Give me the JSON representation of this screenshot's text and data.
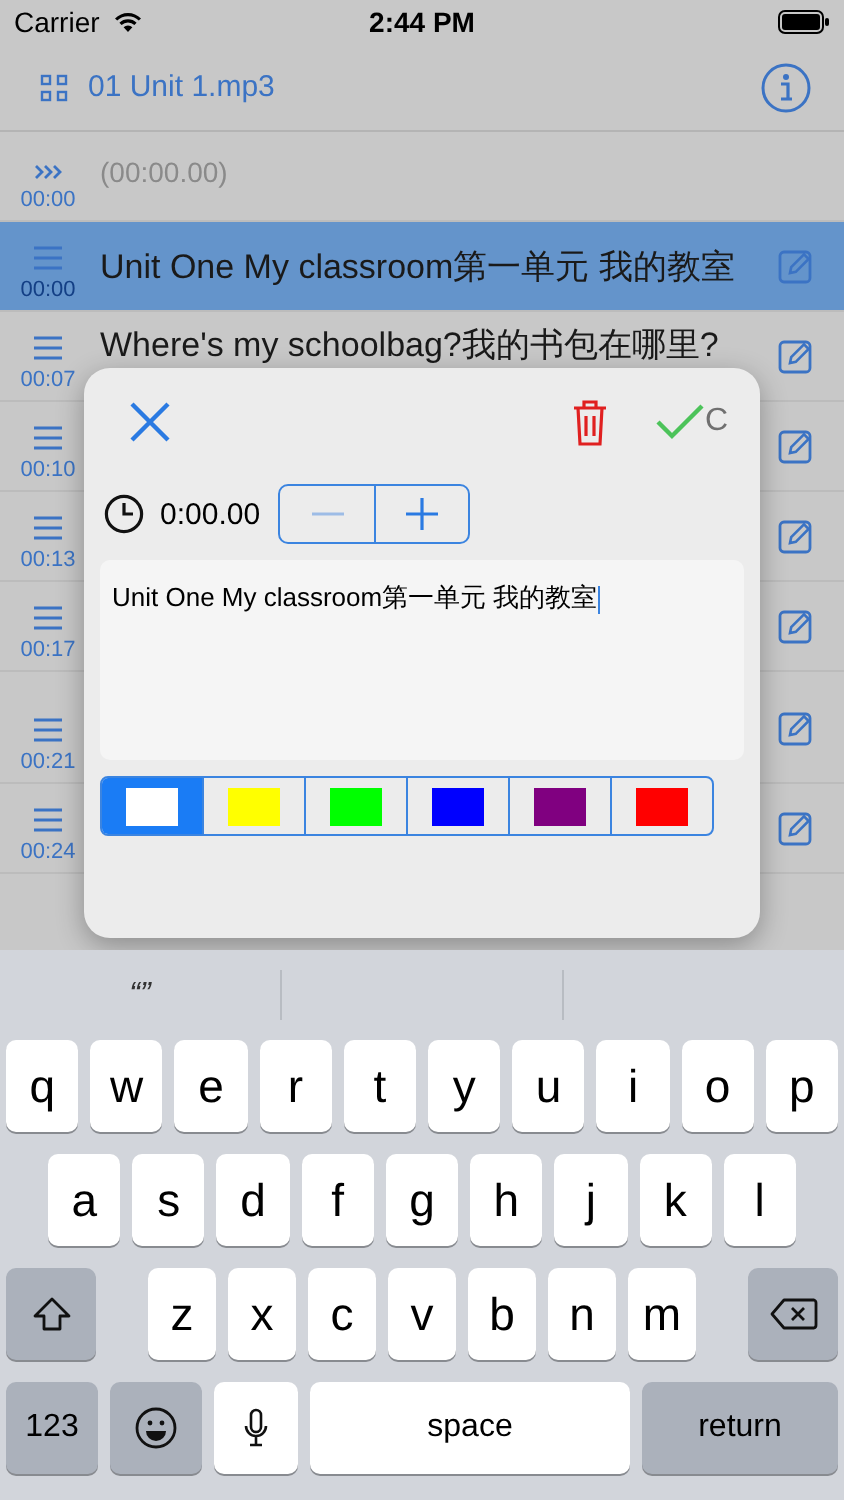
{
  "status_bar": {
    "carrier": "Carrier",
    "time": "2:44 PM"
  },
  "header": {
    "title": "01 Unit 1.mp3"
  },
  "rows": [
    {
      "kind": "start",
      "time": "00:00",
      "text": "(00:00.00)",
      "selected": false
    },
    {
      "kind": "line",
      "time": "00:00",
      "text": "Unit One My classroom第一单元 我的教室",
      "selected": true
    },
    {
      "kind": "line",
      "time": "00:07",
      "text": "Where's my schoolbag?我的书包在哪里?",
      "selected": false
    },
    {
      "kind": "line",
      "time": "00:10",
      "selected": false
    },
    {
      "kind": "line",
      "time": "00:13",
      "selected": false
    },
    {
      "kind": "line",
      "time": "00:17",
      "selected": false
    },
    {
      "kind": "tall",
      "time": "00:21",
      "selected": false
    },
    {
      "kind": "line",
      "time": "00:24",
      "selected": false
    }
  ],
  "dialog": {
    "confirm_label": "C",
    "time": "0:00.00",
    "decrement_disabled": true,
    "text": "Unit One My classroom第一单元 我的教室",
    "colors": [
      {
        "color": "#ffffff",
        "selected": true
      },
      {
        "color": "#ffff00",
        "selected": false
      },
      {
        "color": "#00ff00",
        "selected": false
      },
      {
        "color": "#0000ff",
        "selected": false
      },
      {
        "color": "#800080",
        "selected": false
      },
      {
        "color": "#ff0000",
        "selected": false
      }
    ]
  },
  "keyboard": {
    "suggestions": [
      "“”"
    ],
    "letter_rows": [
      [
        "q",
        "w",
        "e",
        "r",
        "t",
        "y",
        "u",
        "i",
        "o",
        "p"
      ],
      [
        "a",
        "s",
        "d",
        "f",
        "g",
        "h",
        "j",
        "k",
        "l"
      ],
      [
        "z",
        "x",
        "c",
        "v",
        "b",
        "n",
        "m"
      ]
    ],
    "numbers_key": "123",
    "space_key": "space",
    "return_key": "return"
  }
}
